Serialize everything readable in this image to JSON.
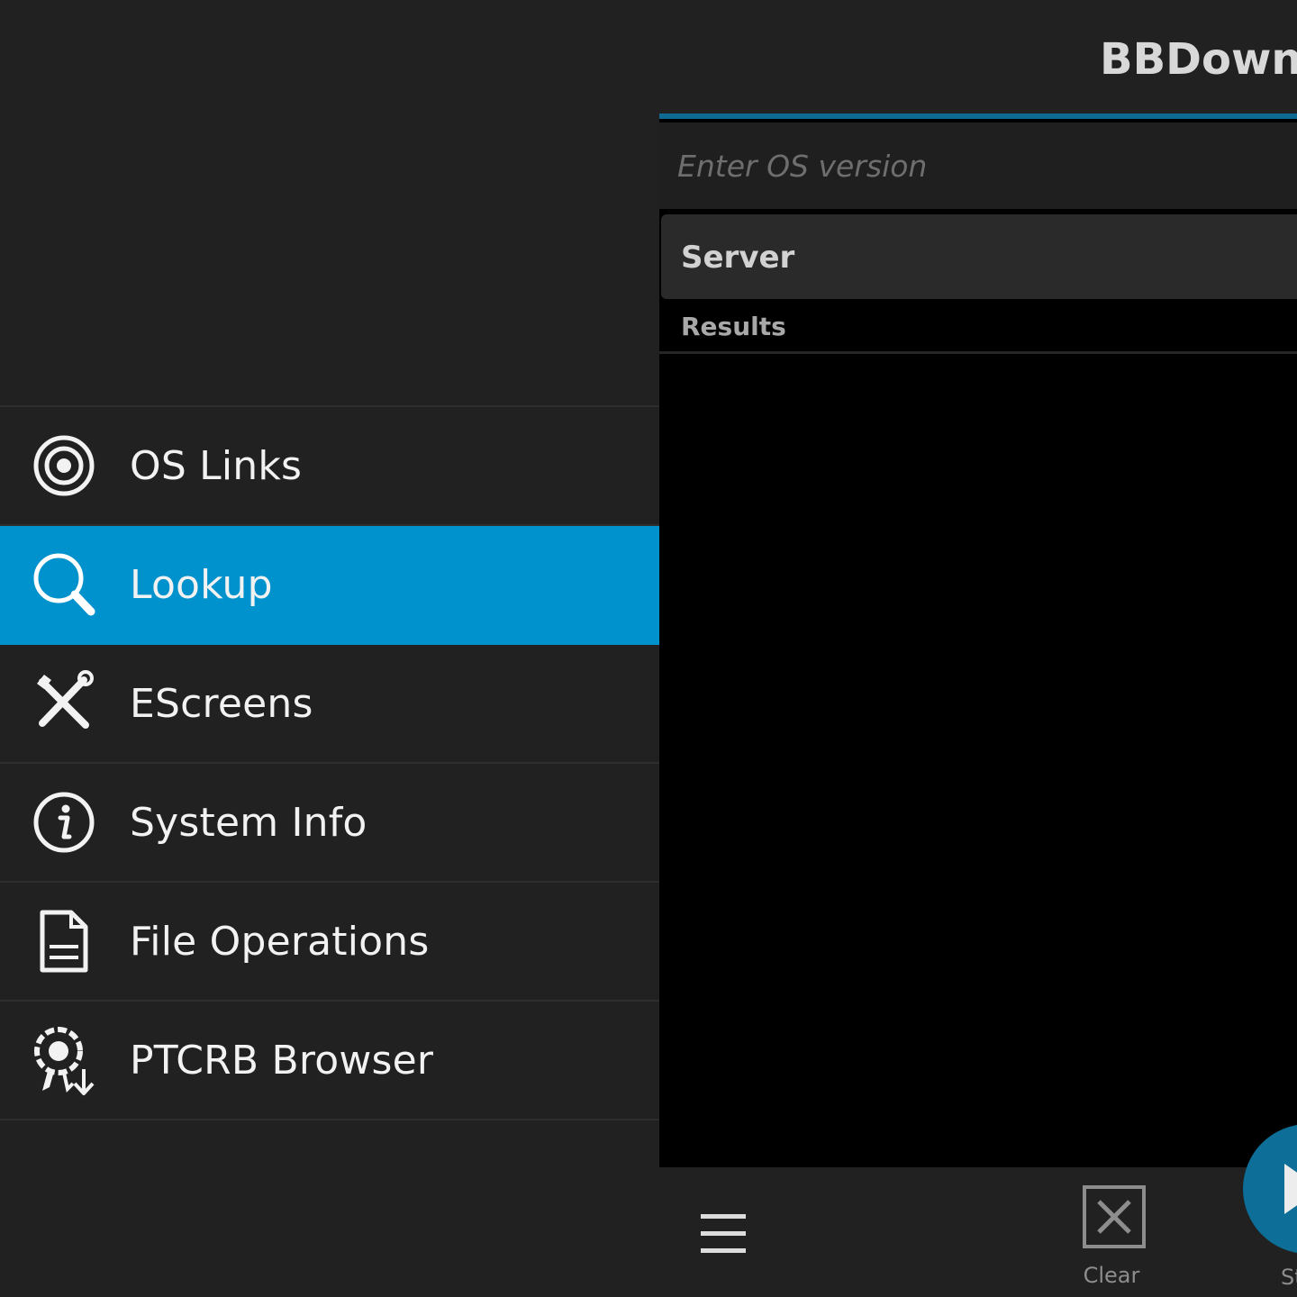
{
  "drawer": {
    "items": [
      {
        "label": "OS Links",
        "icon": "target-icon",
        "active": false
      },
      {
        "label": "Lookup",
        "icon": "search-icon",
        "active": true
      },
      {
        "label": "EScreens",
        "icon": "tools-icon",
        "active": false
      },
      {
        "label": "System Info",
        "icon": "info-icon",
        "active": false
      },
      {
        "label": "File Operations",
        "icon": "document-icon",
        "active": false
      },
      {
        "label": "PTCRB Browser",
        "icon": "certificate-download-icon",
        "active": false
      }
    ],
    "active_color": "#0092cc",
    "background": "#212121"
  },
  "main": {
    "title": "BBDownlo",
    "os_input": {
      "value": "",
      "placeholder": "Enter OS version"
    },
    "server_label": "Server",
    "results_label": "Results"
  },
  "actionbar": {
    "menu_icon": "hamburger-icon",
    "clear_label": "Clear",
    "clear_icon": "close-box-icon",
    "start_label": "St",
    "start_icon": "play-icon",
    "fab_color": "#0d6e98"
  }
}
